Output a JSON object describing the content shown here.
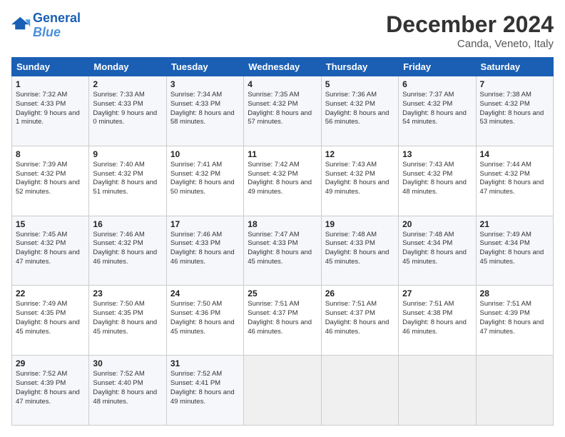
{
  "header": {
    "logo_line1": "General",
    "logo_line2": "Blue",
    "month_title": "December 2024",
    "location": "Canda, Veneto, Italy"
  },
  "days_of_week": [
    "Sunday",
    "Monday",
    "Tuesday",
    "Wednesday",
    "Thursday",
    "Friday",
    "Saturday"
  ],
  "weeks": [
    [
      {
        "day": "1",
        "rise": "Sunrise: 7:32 AM",
        "set": "Sunset: 4:33 PM",
        "light": "Daylight: 9 hours and 1 minute."
      },
      {
        "day": "2",
        "rise": "Sunrise: 7:33 AM",
        "set": "Sunset: 4:33 PM",
        "light": "Daylight: 9 hours and 0 minutes."
      },
      {
        "day": "3",
        "rise": "Sunrise: 7:34 AM",
        "set": "Sunset: 4:33 PM",
        "light": "Daylight: 8 hours and 58 minutes."
      },
      {
        "day": "4",
        "rise": "Sunrise: 7:35 AM",
        "set": "Sunset: 4:32 PM",
        "light": "Daylight: 8 hours and 57 minutes."
      },
      {
        "day": "5",
        "rise": "Sunrise: 7:36 AM",
        "set": "Sunset: 4:32 PM",
        "light": "Daylight: 8 hours and 56 minutes."
      },
      {
        "day": "6",
        "rise": "Sunrise: 7:37 AM",
        "set": "Sunset: 4:32 PM",
        "light": "Daylight: 8 hours and 54 minutes."
      },
      {
        "day": "7",
        "rise": "Sunrise: 7:38 AM",
        "set": "Sunset: 4:32 PM",
        "light": "Daylight: 8 hours and 53 minutes."
      }
    ],
    [
      {
        "day": "8",
        "rise": "Sunrise: 7:39 AM",
        "set": "Sunset: 4:32 PM",
        "light": "Daylight: 8 hours and 52 minutes."
      },
      {
        "day": "9",
        "rise": "Sunrise: 7:40 AM",
        "set": "Sunset: 4:32 PM",
        "light": "Daylight: 8 hours and 51 minutes."
      },
      {
        "day": "10",
        "rise": "Sunrise: 7:41 AM",
        "set": "Sunset: 4:32 PM",
        "light": "Daylight: 8 hours and 50 minutes."
      },
      {
        "day": "11",
        "rise": "Sunrise: 7:42 AM",
        "set": "Sunset: 4:32 PM",
        "light": "Daylight: 8 hours and 49 minutes."
      },
      {
        "day": "12",
        "rise": "Sunrise: 7:43 AM",
        "set": "Sunset: 4:32 PM",
        "light": "Daylight: 8 hours and 49 minutes."
      },
      {
        "day": "13",
        "rise": "Sunrise: 7:43 AM",
        "set": "Sunset: 4:32 PM",
        "light": "Daylight: 8 hours and 48 minutes."
      },
      {
        "day": "14",
        "rise": "Sunrise: 7:44 AM",
        "set": "Sunset: 4:32 PM",
        "light": "Daylight: 8 hours and 47 minutes."
      }
    ],
    [
      {
        "day": "15",
        "rise": "Sunrise: 7:45 AM",
        "set": "Sunset: 4:32 PM",
        "light": "Daylight: 8 hours and 47 minutes."
      },
      {
        "day": "16",
        "rise": "Sunrise: 7:46 AM",
        "set": "Sunset: 4:32 PM",
        "light": "Daylight: 8 hours and 46 minutes."
      },
      {
        "day": "17",
        "rise": "Sunrise: 7:46 AM",
        "set": "Sunset: 4:33 PM",
        "light": "Daylight: 8 hours and 46 minutes."
      },
      {
        "day": "18",
        "rise": "Sunrise: 7:47 AM",
        "set": "Sunset: 4:33 PM",
        "light": "Daylight: 8 hours and 45 minutes."
      },
      {
        "day": "19",
        "rise": "Sunrise: 7:48 AM",
        "set": "Sunset: 4:33 PM",
        "light": "Daylight: 8 hours and 45 minutes."
      },
      {
        "day": "20",
        "rise": "Sunrise: 7:48 AM",
        "set": "Sunset: 4:34 PM",
        "light": "Daylight: 8 hours and 45 minutes."
      },
      {
        "day": "21",
        "rise": "Sunrise: 7:49 AM",
        "set": "Sunset: 4:34 PM",
        "light": "Daylight: 8 hours and 45 minutes."
      }
    ],
    [
      {
        "day": "22",
        "rise": "Sunrise: 7:49 AM",
        "set": "Sunset: 4:35 PM",
        "light": "Daylight: 8 hours and 45 minutes."
      },
      {
        "day": "23",
        "rise": "Sunrise: 7:50 AM",
        "set": "Sunset: 4:35 PM",
        "light": "Daylight: 8 hours and 45 minutes."
      },
      {
        "day": "24",
        "rise": "Sunrise: 7:50 AM",
        "set": "Sunset: 4:36 PM",
        "light": "Daylight: 8 hours and 45 minutes."
      },
      {
        "day": "25",
        "rise": "Sunrise: 7:51 AM",
        "set": "Sunset: 4:37 PM",
        "light": "Daylight: 8 hours and 46 minutes."
      },
      {
        "day": "26",
        "rise": "Sunrise: 7:51 AM",
        "set": "Sunset: 4:37 PM",
        "light": "Daylight: 8 hours and 46 minutes."
      },
      {
        "day": "27",
        "rise": "Sunrise: 7:51 AM",
        "set": "Sunset: 4:38 PM",
        "light": "Daylight: 8 hours and 46 minutes."
      },
      {
        "day": "28",
        "rise": "Sunrise: 7:51 AM",
        "set": "Sunset: 4:39 PM",
        "light": "Daylight: 8 hours and 47 minutes."
      }
    ],
    [
      {
        "day": "29",
        "rise": "Sunrise: 7:52 AM",
        "set": "Sunset: 4:39 PM",
        "light": "Daylight: 8 hours and 47 minutes."
      },
      {
        "day": "30",
        "rise": "Sunrise: 7:52 AM",
        "set": "Sunset: 4:40 PM",
        "light": "Daylight: 8 hours and 48 minutes."
      },
      {
        "day": "31",
        "rise": "Sunrise: 7:52 AM",
        "set": "Sunset: 4:41 PM",
        "light": "Daylight: 8 hours and 49 minutes."
      },
      null,
      null,
      null,
      null
    ]
  ]
}
